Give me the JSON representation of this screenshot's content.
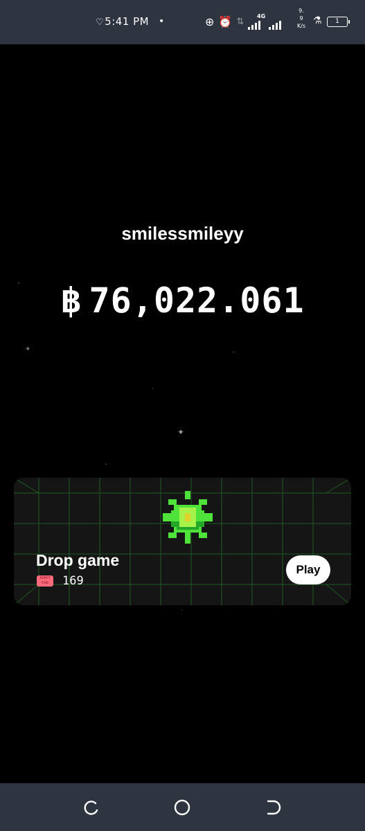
{
  "status_bar": {
    "heart_glyph": "♡",
    "time": "5:41 PM",
    "dot": "•",
    "network_type": "4G",
    "speed_line1": "9.",
    "speed_line2": "9",
    "speed_unit": "K/s",
    "battery_level": "1",
    "icons": [
      "data-saver-icon",
      "alarm-icon",
      "data-arrows-icon",
      "signal-icon",
      "signal-icon",
      "flask-icon",
      "battery-icon"
    ]
  },
  "profile": {
    "username": "smilessmileyy",
    "currency_symbol": "฿",
    "balance": "76,022.061"
  },
  "game_card": {
    "title": "Drop game",
    "ticket_icon_text_1": "ADMIT",
    "ticket_icon_text_2": "ONE",
    "ticket_count": "169",
    "play_label": "Play",
    "accent_color": "#36e036"
  },
  "nav_bar": {
    "icons": [
      "recents-icon",
      "home-icon",
      "back-icon"
    ]
  }
}
